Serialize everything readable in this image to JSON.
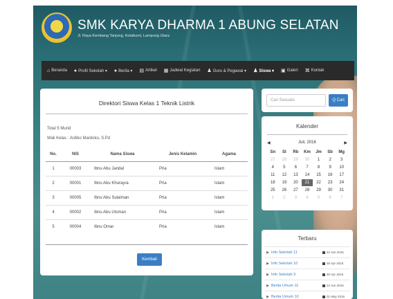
{
  "site": {
    "title": "SMK KARYA DHARMA 1 ABUNG SELATAN",
    "address": "Jl. Raya Kembang Tanjung, Kotabumi, Lampung Utara"
  },
  "nav": {
    "items": [
      {
        "label": "Beranda",
        "icon": "home-icon",
        "glyph": "⌂"
      },
      {
        "label": "Profil Sekolah ▾",
        "icon": "info-icon",
        "glyph": "●"
      },
      {
        "label": "Berita ▾",
        "icon": "info-icon",
        "glyph": "●"
      },
      {
        "label": "Artikel",
        "icon": "list-icon",
        "glyph": "▤"
      },
      {
        "label": "Jadwal Kegiatan",
        "icon": "calendar-icon",
        "glyph": "▦"
      },
      {
        "label": "Guru & Pegawai ▾",
        "icon": "user-icon",
        "glyph": "♟"
      },
      {
        "label": "Siswa ▾",
        "icon": "user-icon",
        "glyph": "♟",
        "active": true
      },
      {
        "label": "Galeri",
        "icon": "image-icon",
        "glyph": "▣"
      },
      {
        "label": "Kontak",
        "icon": "contact-icon",
        "glyph": "⌘"
      }
    ]
  },
  "directory": {
    "title": "Direktori Siswa Kelas 1 Teknik Listrik",
    "total": "Total 5 Murid",
    "homeroom": "Wali Kelas : Ardiko Mardoko, S.Pd",
    "columns": [
      "No.",
      "NIS",
      "Nama Siswa",
      "Jenis Kelamin",
      "Agama"
    ],
    "rows": [
      [
        "1",
        "00003",
        "Ibnu Abu Jandal",
        "Pria",
        "Islam"
      ],
      [
        "2",
        "00001",
        "Ibnu Abu Khurayra",
        "Pria",
        "Islam"
      ],
      [
        "3",
        "00005",
        "Ibnu Abu Sulaiman",
        "Pria",
        "Islam"
      ],
      [
        "4",
        "00002",
        "Ibnu Abu Utsman",
        "Pria",
        "Islam"
      ],
      [
        "5",
        "00004",
        "Ibnu Omar",
        "Pria",
        "Islam"
      ]
    ],
    "back_label": "Kembali"
  },
  "search": {
    "placeholder": "Cari Sesuatu",
    "button_label": "Q Cari"
  },
  "calendar": {
    "title": "Kalender",
    "month": "Juli, 2016",
    "prev": "◀",
    "next": "▶",
    "days": [
      "Sn",
      "Sl",
      "Rb",
      "Km",
      "Jm",
      "Sb",
      "Mg"
    ],
    "weeks": [
      [
        "27",
        "28",
        "29",
        "30",
        "1",
        "2",
        "3"
      ],
      [
        "4",
        "5",
        "6",
        "7",
        "8",
        "9",
        "10"
      ],
      [
        "11",
        "12",
        "13",
        "14",
        "15",
        "16",
        "17"
      ],
      [
        "18",
        "19",
        "20",
        "21",
        "22",
        "23",
        "24"
      ],
      [
        "25",
        "26",
        "27",
        "28",
        "29",
        "30",
        "31"
      ],
      [
        "1",
        "2",
        "3",
        "4",
        "5",
        "6",
        "7"
      ]
    ],
    "today": "21"
  },
  "latest": {
    "title": "Terbaru",
    "items": [
      {
        "label": "Info Sekolah 11",
        "date": "24 Jun 2016"
      },
      {
        "label": "Info Sekolah 10",
        "date": "30 Apr 2016"
      },
      {
        "label": "Info Sekolah 9",
        "date": "30 Apr 2016"
      },
      {
        "label": "Berita Umum 11",
        "date": "24 Jun 2016"
      },
      {
        "label": "Berita Umum 10",
        "date": "01 May 2016"
      }
    ]
  }
}
